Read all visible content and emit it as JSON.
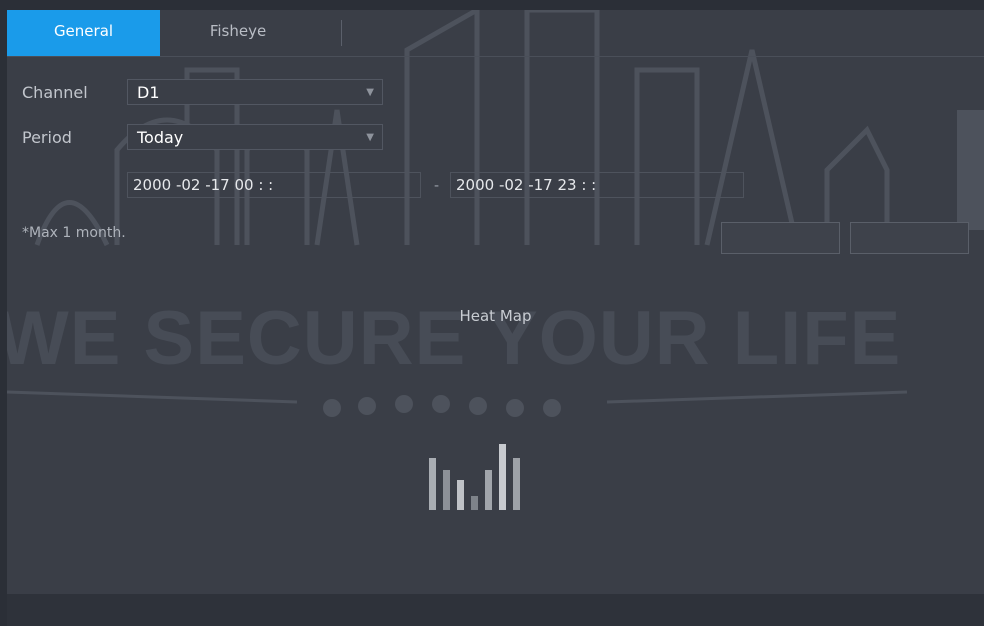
{
  "tabs": [
    {
      "label": "General",
      "active": true
    },
    {
      "label": "Fisheye",
      "active": false
    }
  ],
  "form": {
    "channel_label": "Channel",
    "channel_value": "D1",
    "period_label": "Period",
    "period_value": "Today",
    "start_time": "2000 -02 -17    00 :      :",
    "separator": "-",
    "end_time": "2000 -02 -17    23 :      :",
    "max_note": "*Max 1 month."
  },
  "main": {
    "heatmap_label": "Heat Map"
  },
  "watermark": {
    "text": "WE SECURE YOUR LIFE"
  },
  "colors": {
    "accent": "#1a9bea",
    "panel": "#3a3e47",
    "bars": [
      "#a9adb3",
      "#8d9198",
      "#bfc2c7",
      "#7e838a",
      "#a1a5ab",
      "#c7cacf",
      "#9ea2a8"
    ]
  },
  "icons": [
    "dropdown-arrow-icon",
    "heatmap-bars-icon"
  ]
}
